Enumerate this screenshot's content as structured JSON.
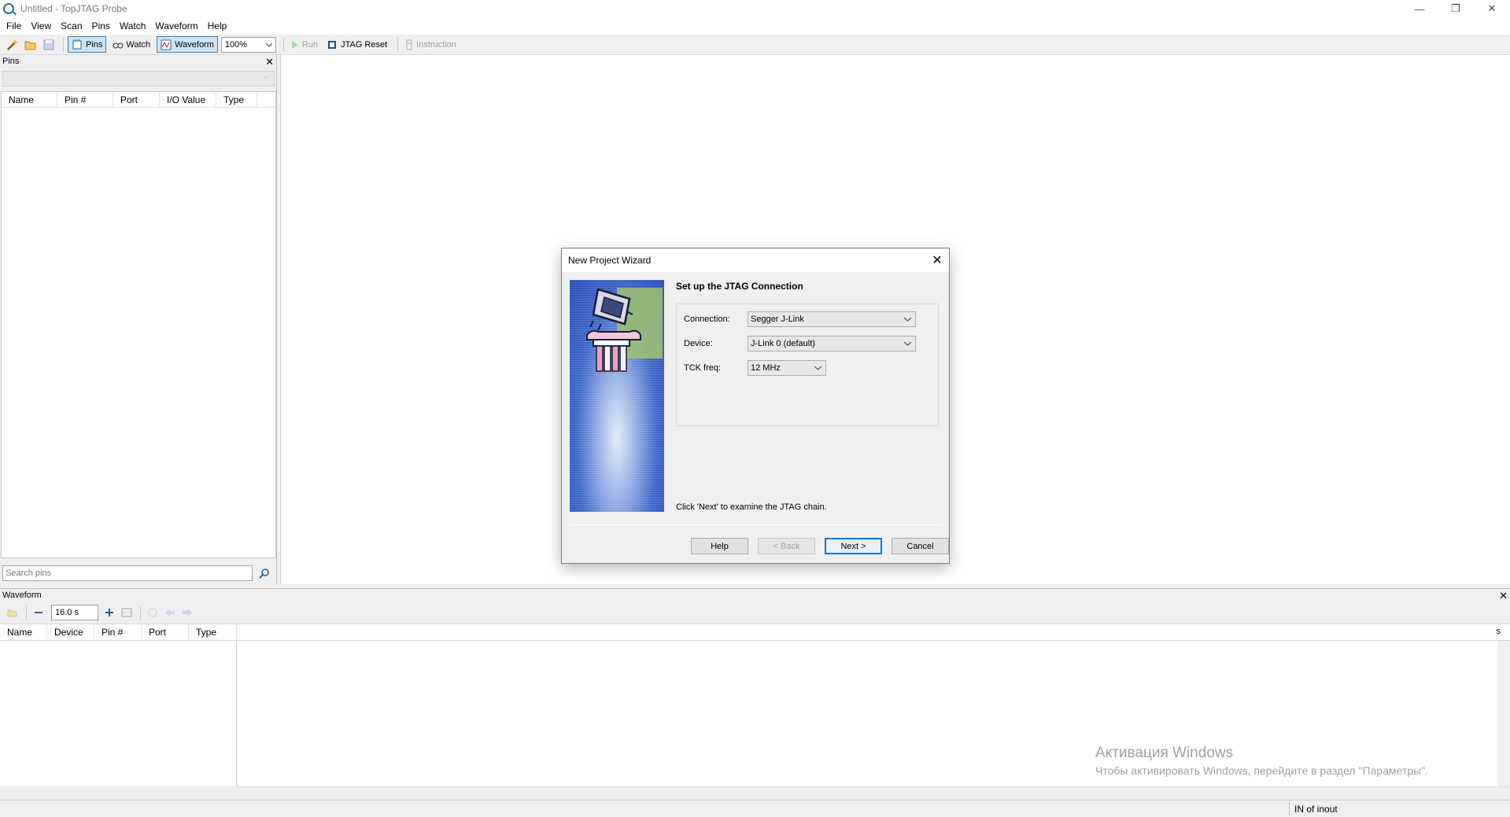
{
  "window": {
    "title": "Untitled - TopJTAG Probe",
    "minimize_glyph": "—",
    "maximize_glyph": "❐",
    "close_glyph": "✕"
  },
  "menu": [
    "File",
    "View",
    "Scan",
    "Pins",
    "Watch",
    "Waveform",
    "Help"
  ],
  "toolbar": {
    "pins_label": "Pins",
    "watch_label": "Watch",
    "waveform_label": "Waveform",
    "zoom_value": "100%",
    "run_label": "Run",
    "jtag_reset_label": "JTAG Reset",
    "instruction_label": "Instruction"
  },
  "pins_panel": {
    "title": "Pins",
    "columns": [
      "Name",
      "Pin #",
      "Port",
      "I/O Value",
      "Type"
    ],
    "search_placeholder": "Search pins"
  },
  "waveform_panel": {
    "title": "Waveform",
    "time_value": "16.0 s",
    "columns": [
      "Name",
      "Device",
      "Pin #",
      "Port",
      "Type"
    ],
    "unit": "s"
  },
  "status": {
    "text": "IN of inout"
  },
  "watermark": {
    "title": "Активация Windows",
    "subtitle": "Чтобы активировать Windows, перейдите в раздел \"Параметры\"."
  },
  "dialog": {
    "title": "New Project Wizard",
    "heading": "Set up the JTAG Connection",
    "connection_label": "Connection:",
    "connection_value": "Segger J-Link",
    "device_label": "Device:",
    "device_value": "J-Link 0 (default)",
    "tck_label": "TCK freq:",
    "tck_value": "12 MHz",
    "hint": "Click 'Next' to examine the JTAG chain.",
    "help_label": "Help",
    "back_label": "< Back",
    "next_label": "Next >",
    "cancel_label": "Cancel"
  },
  "colors": {
    "accent": "#0078d7",
    "toggle_active_bg": "#cce4f7",
    "wizard_image_blue": "#2b4ec0"
  },
  "icons": [
    "app-icon",
    "wand-icon",
    "open-folder-icon",
    "save-icon",
    "pins-icon",
    "watch-icon",
    "waveform-icon",
    "run-icon",
    "jtag-reset-icon",
    "instruction-icon",
    "search-icon",
    "zoom-out-icon",
    "zoom-in-icon",
    "fit-icon",
    "chevron-down-icon",
    "close-icon"
  ]
}
